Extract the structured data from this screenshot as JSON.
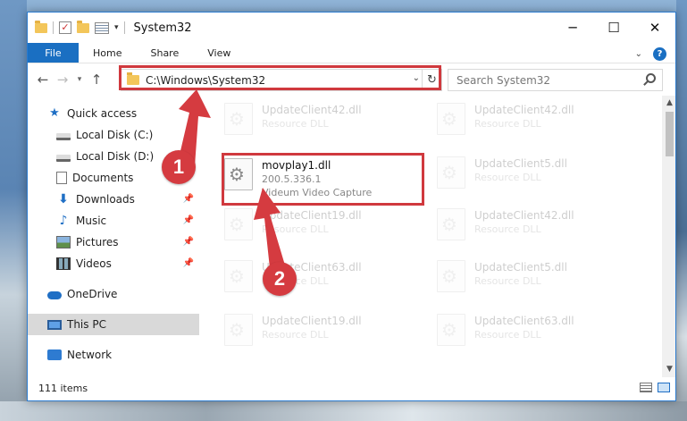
{
  "window": {
    "title": "System32",
    "controls": {
      "minimize": "─",
      "maximize": "☐",
      "close": "✕"
    }
  },
  "ribbon": {
    "file_tab": "File",
    "tabs": [
      "Home",
      "Share",
      "View"
    ],
    "help": "?"
  },
  "nav": {
    "address": "C:\\Windows\\System32",
    "search_placeholder": "Search System32"
  },
  "sidebar": {
    "items": [
      {
        "label": "Quick access",
        "icon": "star-icon",
        "pinned": false
      },
      {
        "label": "Local Disk (C:)",
        "icon": "disk-icon",
        "pinned": true
      },
      {
        "label": "Local Disk (D:)",
        "icon": "disk-icon",
        "pinned": true
      },
      {
        "label": "Documents",
        "icon": "documents-icon",
        "pinned": true
      },
      {
        "label": "Downloads",
        "icon": "downloads-icon",
        "pinned": true
      },
      {
        "label": "Music",
        "icon": "music-icon",
        "pinned": true
      },
      {
        "label": "Pictures",
        "icon": "pictures-icon",
        "pinned": true
      },
      {
        "label": "Videos",
        "icon": "videos-icon",
        "pinned": true
      },
      {
        "label": "OneDrive",
        "icon": "onedrive-icon",
        "pinned": false
      },
      {
        "label": "This PC",
        "icon": "this-pc-icon",
        "pinned": false,
        "selected": true
      },
      {
        "label": "Network",
        "icon": "network-icon",
        "pinned": false
      }
    ]
  },
  "files": {
    "focus": {
      "name": "movplay1.dll",
      "version": "200.5.336.1",
      "description": "Videum Video Capture"
    },
    "left_column": [
      {
        "name": "UpdateClient42.dll",
        "type": "Resource DLL"
      },
      {
        "name": "UpdateClient19.dll",
        "type": "Resource DLL"
      },
      {
        "name": "UpdateClient63.dll",
        "type": "Resource DLL"
      },
      {
        "name": "UpdateClient19.dll",
        "type": "Resource DLL"
      }
    ],
    "right_column": [
      {
        "name": "UpdateClient42.dll",
        "type": "Resource DLL"
      },
      {
        "name": "UpdateClient5.dll",
        "type": "Resource DLL"
      },
      {
        "name": "UpdateClient42.dll",
        "type": "Resource DLL"
      },
      {
        "name": "UpdateClient5.dll",
        "type": "Resource DLL"
      },
      {
        "name": "UpdateClient63.dll",
        "type": "Resource DLL"
      }
    ]
  },
  "status": {
    "items_count": "111 items"
  },
  "annotations": {
    "step1": "1",
    "step2": "2",
    "color": "#d53b40"
  }
}
